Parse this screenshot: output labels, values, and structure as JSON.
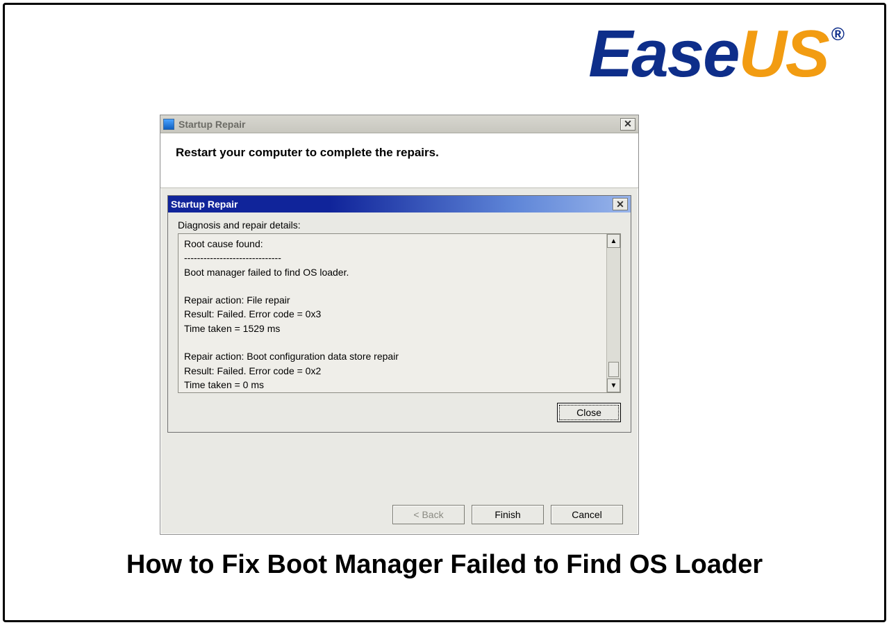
{
  "logo": {
    "part1": "Ease",
    "part2": "US",
    "reg": "®"
  },
  "outer": {
    "title": "Startup Repair",
    "header": "Restart your computer to complete the repairs.",
    "buttons": {
      "back": "< Back",
      "finish": "Finish",
      "cancel": "Cancel"
    }
  },
  "inner": {
    "title": "Startup Repair",
    "section_label": "Diagnosis and repair details:",
    "details": "Root cause found:\n------------------------------\nBoot manager failed to find OS loader.\n\nRepair action: File repair\nResult: Failed. Error code =  0x3\nTime taken = 1529 ms\n\nRepair action: Boot configuration data store repair\nResult: Failed. Error code =  0x2\nTime taken = 0 ms",
    "close": "Close"
  },
  "caption": "How to Fix Boot Manager Failed to Find OS Loader",
  "glyphs": {
    "x": "✕",
    "up": "▲",
    "down": "▼"
  }
}
